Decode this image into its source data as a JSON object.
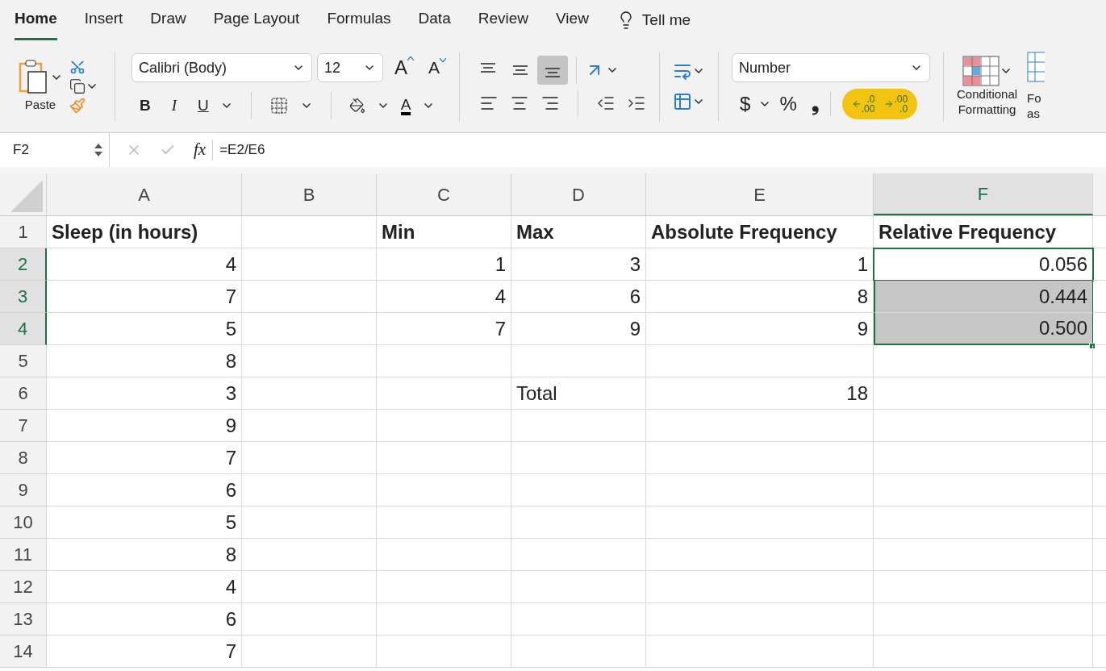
{
  "tabs": [
    {
      "label": "Home",
      "selected": true
    },
    {
      "label": "Insert",
      "selected": false
    },
    {
      "label": "Draw",
      "selected": false
    },
    {
      "label": "Page Layout",
      "selected": false
    },
    {
      "label": "Formulas",
      "selected": false
    },
    {
      "label": "Data",
      "selected": false
    },
    {
      "label": "Review",
      "selected": false
    },
    {
      "label": "View",
      "selected": false
    }
  ],
  "tell_me": "Tell me",
  "ribbon": {
    "paste": "Paste",
    "font_name": "Calibri (Body)",
    "font_size": "12",
    "grow_font": "A",
    "shrink_font": "A",
    "bold": "B",
    "italic": "I",
    "underline": "U",
    "font_color": "A",
    "align_top": {
      "selected": false
    },
    "align_middle": {
      "selected": false
    },
    "align_bottom": {
      "selected": true
    },
    "number_format": "Number",
    "currency": "$",
    "percent": "%",
    "comma": "❟",
    "decimal_buttons": {
      "highlighted": true,
      "increase": [
        ".0",
        ".00"
      ],
      "decrease": [
        ".00",
        ".0"
      ]
    },
    "conditional_formatting": [
      "Conditional",
      "Formatting"
    ],
    "format_as_table": [
      "Fo",
      "as"
    ]
  },
  "formula_bar": {
    "name_box": "F2",
    "fx": "fx",
    "formula": "=E2/E6"
  },
  "columns": [
    {
      "label": "A",
      "selected": false
    },
    {
      "label": "B",
      "selected": false
    },
    {
      "label": "C",
      "selected": false
    },
    {
      "label": "D",
      "selected": false
    },
    {
      "label": "E",
      "selected": false
    },
    {
      "label": "F",
      "selected": true
    }
  ],
  "rows": [
    {
      "header": "1",
      "selected": false,
      "bold": true,
      "cells": [
        {
          "text": "Sleep (in hours)",
          "kind": "text"
        },
        null,
        {
          "text": "Min",
          "kind": "text"
        },
        {
          "text": "Max",
          "kind": "text"
        },
        {
          "text": "Absolute Frequency",
          "kind": "text"
        },
        {
          "text": "Relative Frequency",
          "kind": "text"
        }
      ]
    },
    {
      "header": "2",
      "selected": true,
      "bold": false,
      "cells": [
        {
          "text": "4",
          "kind": "number"
        },
        null,
        {
          "text": "1",
          "kind": "number"
        },
        {
          "text": "3",
          "kind": "number"
        },
        {
          "text": "1",
          "kind": "number"
        },
        {
          "text": "0.056",
          "kind": "number",
          "active": true
        }
      ]
    },
    {
      "header": "3",
      "selected": true,
      "bold": false,
      "cells": [
        {
          "text": "7",
          "kind": "number"
        },
        null,
        {
          "text": "4",
          "kind": "number"
        },
        {
          "text": "6",
          "kind": "number"
        },
        {
          "text": "8",
          "kind": "number"
        },
        {
          "text": "0.444",
          "kind": "number",
          "active": false,
          "selected": true
        }
      ]
    },
    {
      "header": "4",
      "selected": true,
      "bold": false,
      "cells": [
        {
          "text": "5",
          "kind": "number"
        },
        null,
        {
          "text": "7",
          "kind": "number"
        },
        {
          "text": "9",
          "kind": "number"
        },
        {
          "text": "9",
          "kind": "number"
        },
        {
          "text": "0.500",
          "kind": "number",
          "active": false,
          "selected": true
        }
      ]
    },
    {
      "header": "5",
      "selected": false,
      "bold": false,
      "cells": [
        {
          "text": "8",
          "kind": "number"
        }
      ]
    },
    {
      "header": "6",
      "selected": false,
      "bold": false,
      "cells": [
        {
          "text": "3",
          "kind": "number"
        },
        null,
        null,
        {
          "text": "Total",
          "kind": "text"
        },
        {
          "text": "18",
          "kind": "number"
        }
      ]
    },
    {
      "header": "7",
      "selected": false,
      "bold": false,
      "cells": [
        {
          "text": "9",
          "kind": "number"
        }
      ]
    },
    {
      "header": "8",
      "selected": false,
      "bold": false,
      "cells": [
        {
          "text": "7",
          "kind": "number"
        }
      ]
    },
    {
      "header": "9",
      "selected": false,
      "bold": false,
      "cells": [
        {
          "text": "6",
          "kind": "number"
        }
      ]
    },
    {
      "header": "10",
      "selected": false,
      "bold": false,
      "cells": [
        {
          "text": "5",
          "kind": "number"
        }
      ]
    },
    {
      "header": "11",
      "selected": false,
      "bold": false,
      "cells": [
        {
          "text": "8",
          "kind": "number"
        }
      ]
    },
    {
      "header": "12",
      "selected": false,
      "bold": false,
      "cells": [
        {
          "text": "4",
          "kind": "number"
        }
      ]
    },
    {
      "header": "13",
      "selected": false,
      "bold": false,
      "cells": [
        {
          "text": "6",
          "kind": "number"
        }
      ]
    },
    {
      "header": "14",
      "selected": false,
      "bold": false,
      "cells": [
        {
          "text": "7",
          "kind": "number"
        }
      ]
    }
  ]
}
